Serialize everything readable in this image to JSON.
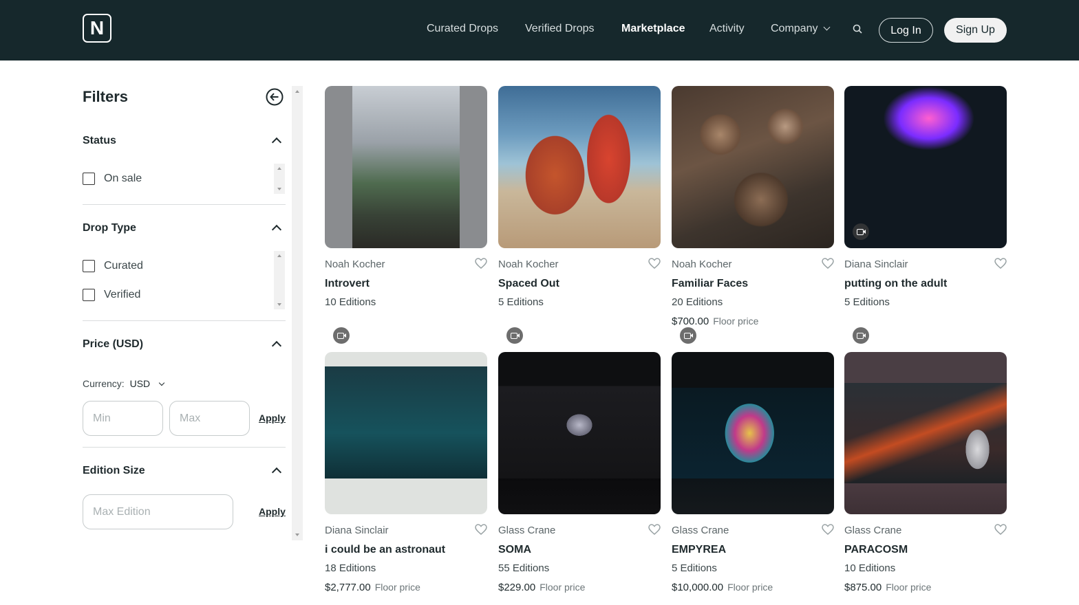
{
  "header": {
    "logo_letter": "N",
    "nav": [
      "Curated Drops",
      "Verified Drops",
      "Marketplace",
      "Activity",
      "Company"
    ],
    "active_nav": "Marketplace",
    "login_label": "Log In",
    "signup_label": "Sign Up"
  },
  "sidebar": {
    "title": "Filters",
    "status": {
      "title": "Status",
      "options": [
        {
          "label": "On sale",
          "checked": false
        }
      ]
    },
    "drop_type": {
      "title": "Drop Type",
      "options": [
        {
          "label": "Curated",
          "checked": false
        },
        {
          "label": "Verified",
          "checked": false
        }
      ]
    },
    "price": {
      "title": "Price (USD)",
      "currency_label": "Currency:",
      "currency_value": "USD",
      "min_placeholder": "Min",
      "max_placeholder": "Max",
      "apply_label": "Apply"
    },
    "edition_size": {
      "title": "Edition Size",
      "placeholder": "Max Edition",
      "apply_label": "Apply"
    }
  },
  "cards": [
    {
      "artist": "Noah Kocher",
      "title": "Introvert",
      "editions": "10 Editions",
      "price": "",
      "floor_label": "",
      "video": false
    },
    {
      "artist": "Noah Kocher",
      "title": "Spaced Out",
      "editions": "5 Editions",
      "price": "",
      "floor_label": "",
      "video": false
    },
    {
      "artist": "Noah Kocher",
      "title": "Familiar Faces",
      "editions": "20 Editions",
      "price": "$700.00",
      "floor_label": "Floor price",
      "video": false
    },
    {
      "artist": "Diana Sinclair",
      "title": "putting on the adult",
      "editions": "5 Editions",
      "price": "",
      "floor_label": "",
      "video": true
    },
    {
      "artist": "Diana Sinclair",
      "title": "i could be an astronaut",
      "editions": "18 Editions",
      "price": "$2,777.00",
      "floor_label": "Floor price",
      "video": true
    },
    {
      "artist": "Glass Crane",
      "title": "SOMA",
      "editions": "55 Editions",
      "price": "$229.00",
      "floor_label": "Floor price",
      "video": true
    },
    {
      "artist": "Glass Crane",
      "title": "EMPYREA",
      "editions": "5 Editions",
      "price": "$10,000.00",
      "floor_label": "Floor price",
      "video": true
    },
    {
      "artist": "Glass Crane",
      "title": "PARACOSM",
      "editions": "10 Editions",
      "price": "$875.00",
      "floor_label": "Floor price",
      "video": true
    }
  ],
  "colors": {
    "header_bg": "#16282c",
    "text": "#1f2a2d",
    "muted": "#5b6568"
  }
}
